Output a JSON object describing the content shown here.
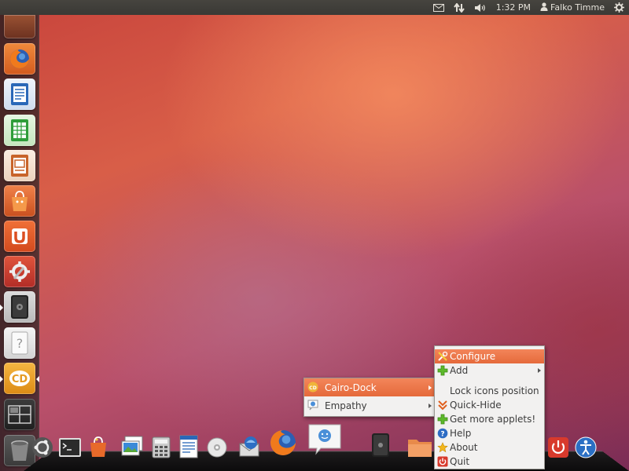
{
  "top_panel": {
    "time": "1:32 PM",
    "user": "Falko Timme",
    "icons": [
      "mail-icon",
      "network-icon",
      "volume-icon",
      "user-icon",
      "power-gear-icon"
    ]
  },
  "launcher": {
    "items": [
      {
        "name": "bfb",
        "color": "#7a3b2c"
      },
      {
        "name": "firefox",
        "color": "#e36a22"
      },
      {
        "name": "libreoffice-writer",
        "color": "#2a68b8"
      },
      {
        "name": "libreoffice-calc",
        "color": "#2f9d3a"
      },
      {
        "name": "libreoffice-impress",
        "color": "#c8642a"
      },
      {
        "name": "ubuntu-software-center",
        "color": "#d95a26"
      },
      {
        "name": "ubuntu-one",
        "color": "#dc4f22"
      },
      {
        "name": "system-settings",
        "color": "#c7352f"
      },
      {
        "name": "safe",
        "color": "#3a3a3a"
      },
      {
        "name": "unknown-app",
        "color": "#cccccc"
      },
      {
        "name": "cairo-dock",
        "color": "#e59a22"
      },
      {
        "name": "workspace-switcher",
        "color": "#333333"
      },
      {
        "name": "trash",
        "color": "#666666"
      }
    ]
  },
  "dock": {
    "items": [
      "ubuntu-logo",
      "terminal",
      "shopping-bag",
      "image-viewer",
      "calculator",
      "text-editor",
      "cd",
      "mail",
      "firefox",
      "empathy",
      "safe",
      "folder",
      "power",
      "accessibility"
    ]
  },
  "context_menu": {
    "items": [
      {
        "label": "Cairo-Dock",
        "icon": "cairo-dock-icon",
        "submenu": true,
        "highlighted": true
      },
      {
        "label": "Empathy",
        "icon": "empathy-icon",
        "submenu": true,
        "highlighted": false
      }
    ]
  },
  "main_menu": {
    "items": [
      {
        "label": "Configure",
        "icon": "configure-icon",
        "highlighted": true
      },
      {
        "label": "Add",
        "icon": "add-icon",
        "submenu": true
      },
      {
        "label": "Lock icons position",
        "icon": ""
      },
      {
        "label": "Quick-Hide",
        "icon": "quick-hide-icon"
      },
      {
        "label": "Get more applets!",
        "icon": "add-icon"
      },
      {
        "label": "Help",
        "icon": "help-icon"
      },
      {
        "label": "About",
        "icon": "about-icon"
      },
      {
        "label": "Quit",
        "icon": "quit-icon"
      }
    ]
  }
}
